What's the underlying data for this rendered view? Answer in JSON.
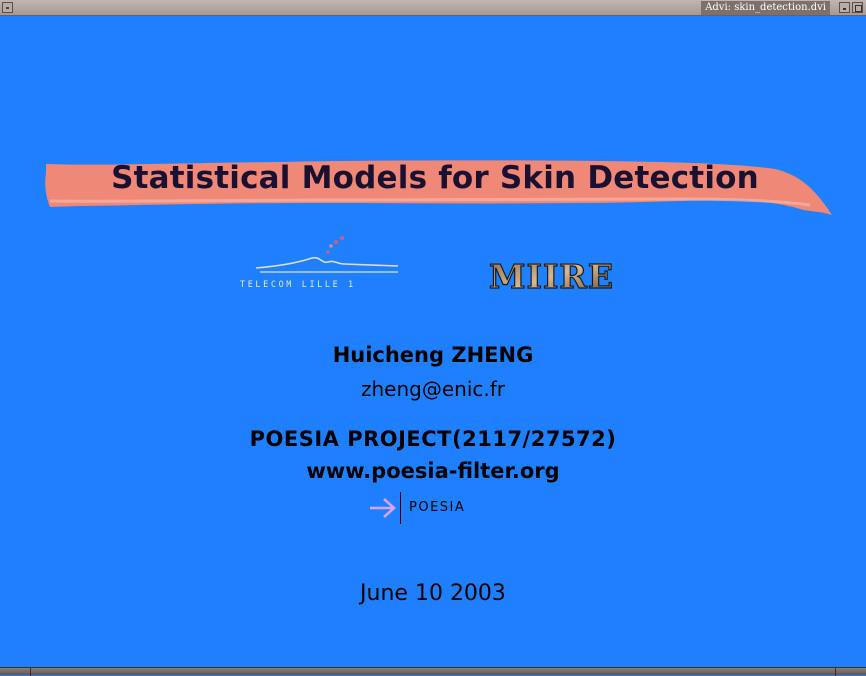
{
  "window": {
    "title": "Advi: skin_detection.dvi"
  },
  "slide": {
    "title": "Statistical Models for Skin Detection",
    "logos": {
      "telecom": "TELECOM LILLE 1",
      "miire": "MIIRE",
      "poesia": "POESIA"
    },
    "author": "Huicheng ZHENG",
    "email": "zheng@enic.fr",
    "project": "POESIA PROJECT(2117/27572)",
    "url": "www.poesia-filter.org",
    "date": "June 10 2003"
  },
  "colors": {
    "background": "#1e7fff",
    "banner": "#f08878",
    "titlebar": "#b0a49f",
    "poesia_arrow": "#d9a2ff"
  },
  "icons": [
    "window-menu-icon",
    "minimize-icon",
    "maximize-icon",
    "poesia-arrow-icon"
  ]
}
